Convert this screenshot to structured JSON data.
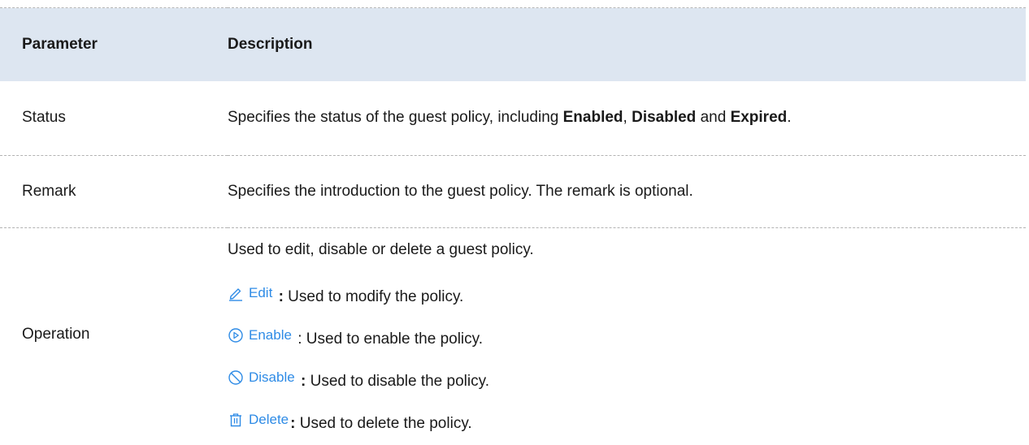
{
  "table": {
    "headers": {
      "parameter": "Parameter",
      "description": "Description"
    },
    "rows": {
      "status": {
        "param": "Status",
        "desc_prefix": "Specifies the status of the guest policy, including ",
        "val1": "Enabled",
        "sep1": ", ",
        "val2": "Disabled",
        "sep2": " and ",
        "val3": "Expired",
        "desc_suffix": "."
      },
      "remark": {
        "param": "Remark",
        "desc": "Specifies the introduction to the guest policy. The remark is optional."
      },
      "operation": {
        "param": "Operation",
        "intro": "Used to edit, disable or delete a guest policy.",
        "items": [
          {
            "icon": "edit-icon",
            "label": "Edit",
            "sep": " :",
            "text": " Used to modify the policy."
          },
          {
            "icon": "enable-icon",
            "label": "Enable",
            "sep": " :",
            "text": " Used to enable the policy."
          },
          {
            "icon": "disable-icon",
            "label": "Disable",
            "sep": " :",
            "text": " Used to disable the policy."
          },
          {
            "icon": "delete-icon",
            "label": "Delete",
            "sep": ":",
            "text": " Used to delete the policy."
          }
        ]
      }
    }
  },
  "colors": {
    "header_bg": "#dde6f1",
    "link_blue": "#2e8be6"
  }
}
